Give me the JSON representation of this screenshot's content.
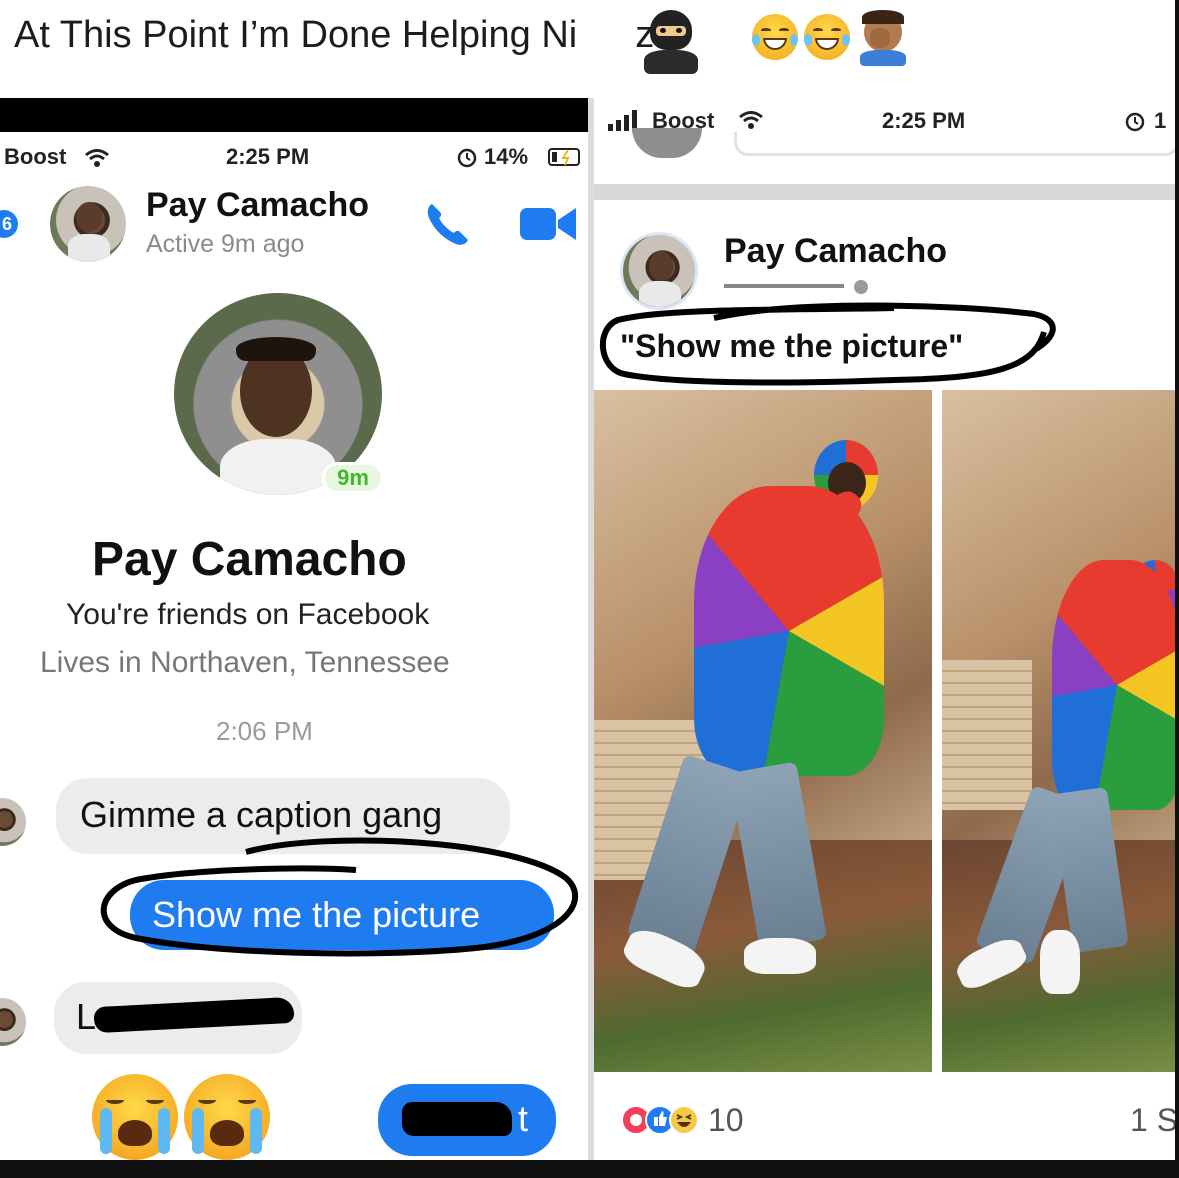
{
  "caption": {
    "text": "At This Point I’m Done Helping Ni",
    "text_tail": "z"
  },
  "left": {
    "status": {
      "carrier": "Boost",
      "time": "2:25 PM",
      "battery": "14%"
    },
    "header": {
      "badge": "6",
      "name": "Pay Camacho",
      "active": "Active 9m ago"
    },
    "profile": {
      "active_badge": "9m",
      "name": "Pay Camacho",
      "friends": "You're friends on Facebook",
      "lives": "Lives in Northaven, Tennessee",
      "time": "2:06 PM"
    },
    "messages": [
      {
        "text": "Gimme a caption gang"
      },
      {
        "text": "Show me the picture"
      },
      {
        "text": "L"
      },
      {
        "text": "t"
      }
    ]
  },
  "right": {
    "status": {
      "carrier": "Boost",
      "time": "2:25 PM",
      "extra": "1"
    },
    "post": {
      "name": "Pay Camacho",
      "caption": "\"Show me the picture\"",
      "reactions": "10",
      "shares": "1 S"
    }
  },
  "colors": {
    "accent": "#1e7cf0",
    "online": "#42b72a"
  },
  "icons": [
    "phone-icon",
    "video-icon",
    "wifi-icon",
    "alarm-icon",
    "signal-icon",
    "globe-icon",
    "like-icon",
    "love-icon",
    "haha-icon"
  ]
}
